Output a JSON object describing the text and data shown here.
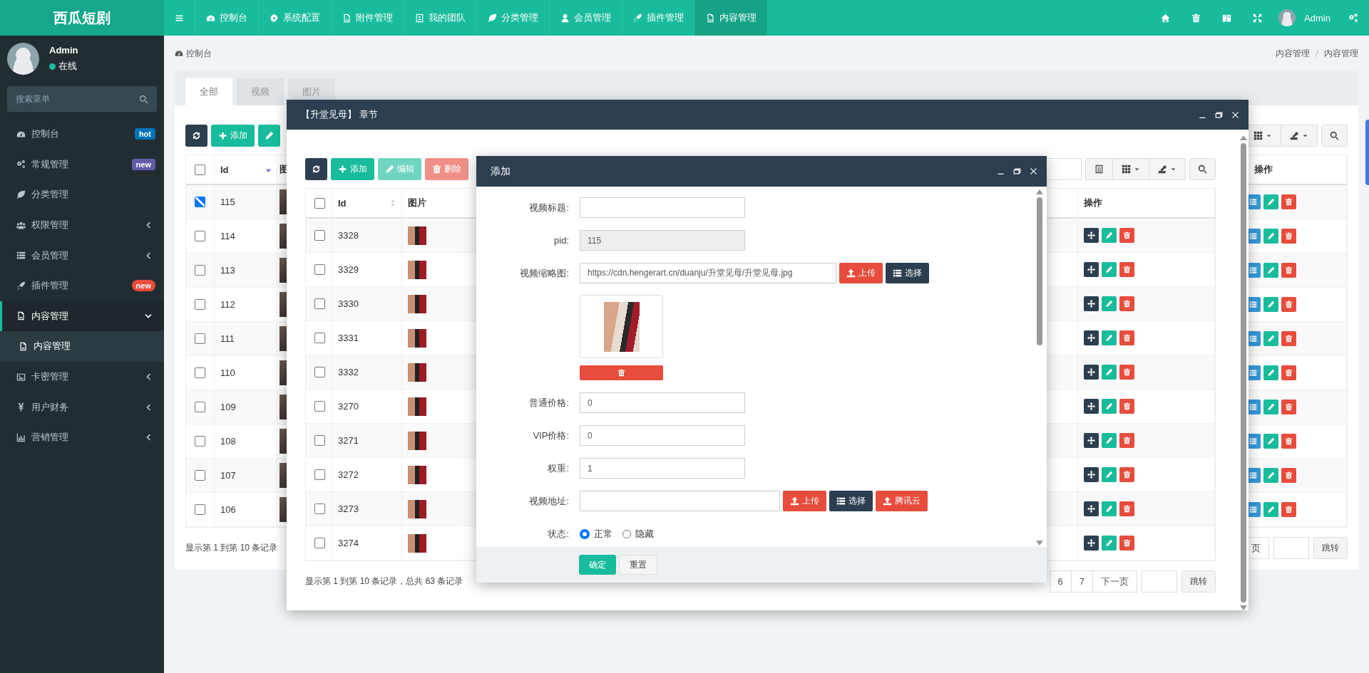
{
  "topbar": {
    "logo": "西瓜短剧",
    "nav": [
      {
        "label": "控制台",
        "selected": false
      },
      {
        "label": "系统配置",
        "selected": false
      },
      {
        "label": "附件管理",
        "selected": false
      },
      {
        "label": "我的团队",
        "selected": false
      },
      {
        "label": "分类管理",
        "selected": false
      },
      {
        "label": "会员管理",
        "selected": false
      },
      {
        "label": "插件管理",
        "selected": false
      },
      {
        "label": "内容管理",
        "selected": true
      }
    ],
    "user": {
      "name": "Admin"
    }
  },
  "sidebar": {
    "user": {
      "name": "Admin",
      "status": "在线"
    },
    "search": {
      "placeholder": "搜索菜单"
    },
    "items": [
      {
        "kind": "link",
        "label": "控制台",
        "selected": false,
        "badge": {
          "text": "hot",
          "color": "#0073b7"
        }
      },
      {
        "kind": "link",
        "label": "常规管理",
        "selected": false,
        "badge": {
          "text": "new",
          "color": "#605ca8"
        }
      },
      {
        "kind": "link",
        "label": "分类管理",
        "selected": false
      },
      {
        "kind": "folder",
        "label": "权限管理",
        "selected": false,
        "expanded": false
      },
      {
        "kind": "folder",
        "label": "会员管理",
        "selected": false,
        "expanded": false
      },
      {
        "kind": "link",
        "label": "插件管理",
        "selected": false,
        "badge": {
          "text": "new",
          "color": "#e74c3c"
        }
      },
      {
        "kind": "folder",
        "label": "内容管理",
        "selected": true,
        "expanded": true,
        "children": [
          {
            "label": "内容管理",
            "selected": true
          }
        ]
      },
      {
        "kind": "folder",
        "label": "卡密管理",
        "selected": false,
        "expanded": false
      },
      {
        "kind": "folder",
        "label": "用户财务",
        "selected": false,
        "expanded": false
      },
      {
        "kind": "folder",
        "label": "营销管理",
        "selected": false,
        "expanded": false
      }
    ]
  },
  "breadcrumb": {
    "home": "控制台",
    "path": [
      "内容管理",
      "内容管理"
    ]
  },
  "panel": {
    "tabs": [
      {
        "label": "全部",
        "selected": true
      },
      {
        "label": "视频",
        "selected": false
      },
      {
        "label": "图片",
        "selected": false
      }
    ],
    "add_button": "添加",
    "table": {
      "columns": [
        "Id",
        "图"
      ],
      "action_column": "操作",
      "all_checked": false,
      "rows": [
        {
          "id": "115",
          "checked": true
        },
        {
          "id": "114",
          "checked": false
        },
        {
          "id": "113",
          "checked": false
        },
        {
          "id": "112",
          "checked": false
        },
        {
          "id": "111",
          "checked": false
        },
        {
          "id": "110",
          "checked": false
        },
        {
          "id": "109",
          "checked": false
        },
        {
          "id": "108",
          "checked": false
        },
        {
          "id": "107",
          "checked": false
        },
        {
          "id": "106",
          "checked": false
        }
      ]
    },
    "footer": "显示第 1 到第 10 条记录",
    "pagination": {
      "pages": [
        "页"
      ],
      "jump": "跳转"
    }
  },
  "chapter_dialog": {
    "title": "【升堂见母】 章节",
    "toolbar": [
      {
        "kind": "add",
        "label": "添加",
        "disabled": false
      },
      {
        "kind": "edit",
        "label": "编辑",
        "disabled": true
      },
      {
        "kind": "delete",
        "label": "删除",
        "disabled": true
      }
    ],
    "table": {
      "columns": [
        "Id",
        "图片"
      ],
      "action_column": "操作",
      "all_checked": false,
      "rows": [
        {
          "id": "3328",
          "checked": false
        },
        {
          "id": "3329",
          "checked": false
        },
        {
          "id": "3330",
          "checked": false
        },
        {
          "id": "3331",
          "checked": false
        },
        {
          "id": "3332",
          "checked": false
        },
        {
          "id": "3270",
          "checked": false
        },
        {
          "id": "3271",
          "checked": false
        },
        {
          "id": "3272",
          "checked": false
        },
        {
          "id": "3273",
          "checked": false
        },
        {
          "id": "3274",
          "checked": false
        }
      ]
    },
    "footer": "显示第 1 到第 10 条记录，总共 63 条记录",
    "pagination": {
      "pages": [
        "6",
        "7",
        "下一页"
      ],
      "jump": "跳转"
    }
  },
  "add_dialog": {
    "title": "添加",
    "fields": [
      {
        "kind": "text",
        "label": "视频标题:",
        "disabled": false
      },
      {
        "kind": "text",
        "label": "pid:",
        "value": "115",
        "disabled": true
      },
      {
        "kind": "upload",
        "label": "视频缩略图:",
        "value": "https://cdn.hengerart.cn/duanju/升堂见母/升堂见母.jpg",
        "preview": true,
        "buttons": [
          {
            "kind": "upload",
            "label": "上传"
          },
          {
            "kind": "choose",
            "label": "选择"
          }
        ]
      },
      {
        "kind": "text",
        "label": "普通价格:",
        "value": "0",
        "disabled": false
      },
      {
        "kind": "text",
        "label": "VIP价格:",
        "value": "0",
        "disabled": false
      },
      {
        "kind": "text",
        "label": "权重:",
        "value": "1",
        "disabled": false
      },
      {
        "kind": "upload",
        "label": "视频地址:",
        "buttons": [
          {
            "kind": "upload",
            "label": "上传"
          },
          {
            "kind": "choose",
            "label": "选择"
          },
          {
            "kind": "upload",
            "label": "腾讯云"
          }
        ]
      },
      {
        "kind": "radio",
        "label": "状态:",
        "options": [
          {
            "label": "正常",
            "selected": true
          },
          {
            "label": "隐藏",
            "selected": false
          }
        ]
      }
    ],
    "buttons": [
      {
        "kind": "primary",
        "label": "确定"
      },
      {
        "kind": "default",
        "label": "重置"
      }
    ]
  }
}
